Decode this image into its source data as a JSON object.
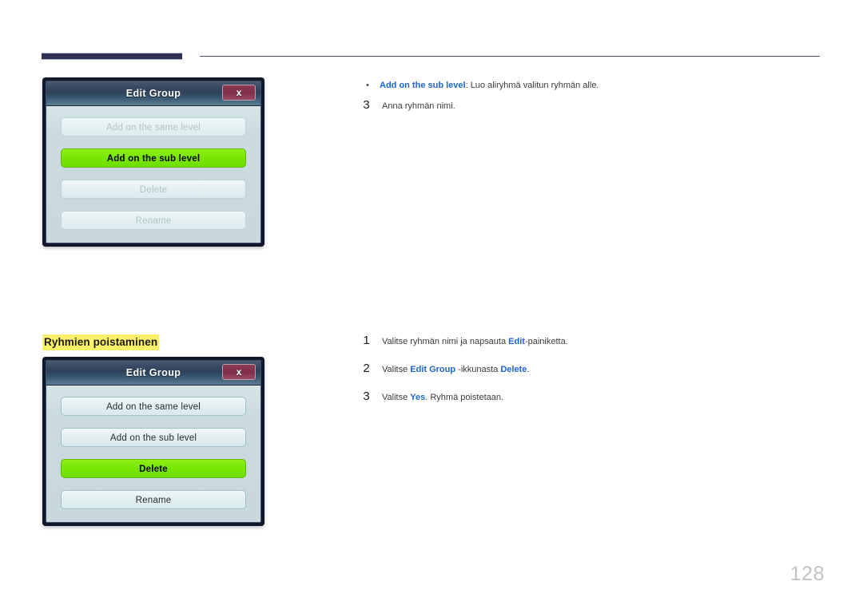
{
  "page": {
    "number": "128"
  },
  "header": {
    "rule_color": "#2e3054"
  },
  "dialogs": {
    "add_sub_level": {
      "title": "Edit Group",
      "close_label": "x",
      "buttons": [
        {
          "label": "Add on the same level",
          "state": "disabled"
        },
        {
          "label": "Add on the sub level",
          "state": "selected"
        },
        {
          "label": "Delete",
          "state": "disabled"
        },
        {
          "label": "Rename",
          "state": "disabled"
        }
      ]
    },
    "delete_group": {
      "title": "Edit Group",
      "close_label": "x",
      "buttons": [
        {
          "label": "Add on the same level",
          "state": "normal"
        },
        {
          "label": "Add on the sub level",
          "state": "normal"
        },
        {
          "label": "Delete",
          "state": "selected"
        },
        {
          "label": "Rename",
          "state": "normal"
        }
      ]
    }
  },
  "top_section": {
    "bullet": {
      "marker": "•",
      "keyword": "Add on the sub level",
      "rest": ": Luo aliryhmä valitun ryhmän alle."
    },
    "step3": {
      "number": "3",
      "text": "Anna ryhmän nimi."
    }
  },
  "delete_section": {
    "heading": "Ryhmien poistaminen",
    "steps": [
      {
        "number": "1",
        "pre": "Valitse ryhmän nimi ja napsauta ",
        "kw1": "Edit",
        "post": "-painiketta."
      },
      {
        "number": "2",
        "pre": "Valitse ",
        "kw1": "Edit Group",
        "mid": " -ikkunasta ",
        "kw2": "Delete",
        "post": "."
      },
      {
        "number": "3",
        "pre": "Valitse ",
        "kw1": "Yes",
        "post": ". Ryhmä poistetaan."
      }
    ]
  },
  "colors": {
    "accent_blue": "#1f66c9",
    "highlight_yellow": "#fbf06a",
    "selected_green": "#79e802",
    "close_maroon": "#7e3049",
    "navy": "#2e3054"
  }
}
